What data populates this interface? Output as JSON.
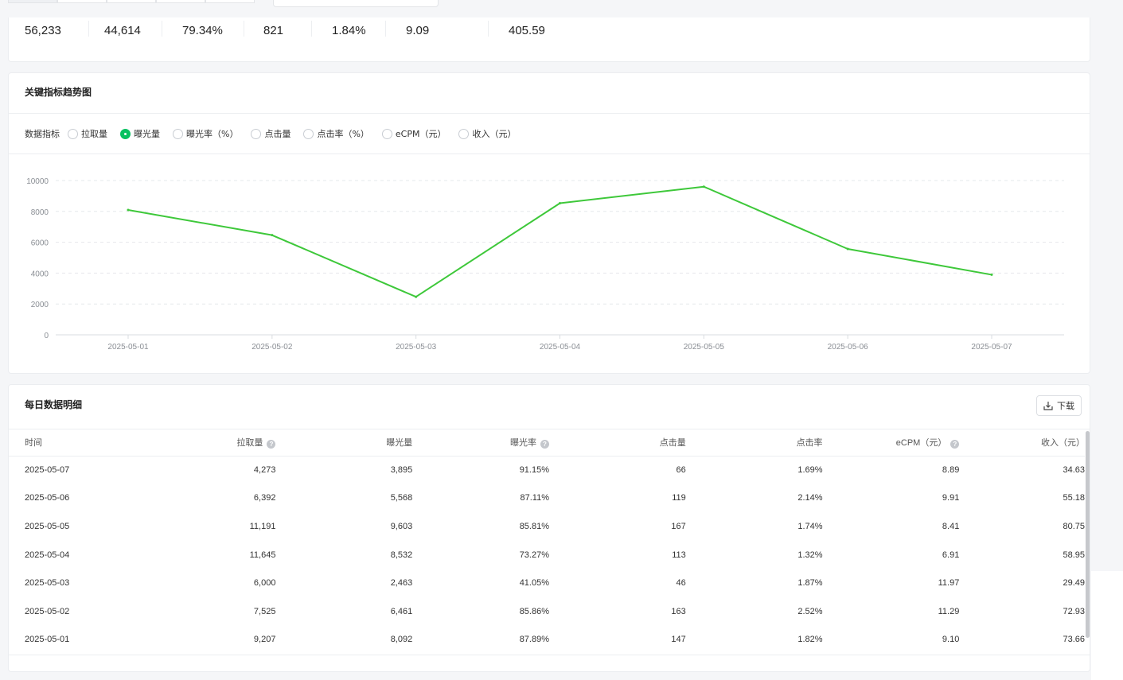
{
  "summary": {
    "values": [
      "56,233",
      "44,614",
      "79.34%",
      "821",
      "1.84%",
      "9.09",
      "405.59"
    ]
  },
  "chart_section": {
    "title": "关键指标趋势图",
    "metric_label": "数据指标",
    "metrics": [
      "拉取量",
      "曝光量",
      "曝光率（%）",
      "点击量",
      "点击率（%）",
      "eCPM（元）",
      "收入（元）"
    ],
    "selected_metric": "曝光量"
  },
  "chart_data": {
    "type": "line",
    "x": [
      "2025-05-01",
      "2025-05-02",
      "2025-05-03",
      "2025-05-04",
      "2025-05-05",
      "2025-05-06",
      "2025-05-07"
    ],
    "series": [
      {
        "values": [
          8092,
          6461,
          2463,
          8532,
          9603,
          5568,
          3895
        ]
      }
    ],
    "yticks": [
      "0",
      "2000",
      "4000",
      "6000",
      "8000",
      "10000"
    ],
    "ylim": [
      0,
      10000
    ],
    "grid": true,
    "line_color": "#3ec83a"
  },
  "table_section": {
    "title": "每日数据明细",
    "download_label": "下载",
    "columns": [
      "时间",
      "拉取量",
      "曝光量",
      "曝光率",
      "点击量",
      "点击率",
      "eCPM（元）",
      "收入（元）"
    ],
    "rows": [
      [
        "2025-05-07",
        "4,273",
        "3,895",
        "91.15%",
        "66",
        "1.69%",
        "8.89",
        "34.63"
      ],
      [
        "2025-05-06",
        "6,392",
        "5,568",
        "87.11%",
        "119",
        "2.14%",
        "9.91",
        "55.18"
      ],
      [
        "2025-05-05",
        "11,191",
        "9,603",
        "85.81%",
        "167",
        "1.74%",
        "8.41",
        "80.75"
      ],
      [
        "2025-05-04",
        "11,645",
        "8,532",
        "73.27%",
        "113",
        "1.32%",
        "6.91",
        "58.95"
      ],
      [
        "2025-05-03",
        "6,000",
        "2,463",
        "41.05%",
        "46",
        "1.87%",
        "11.97",
        "29.49"
      ],
      [
        "2025-05-02",
        "7,525",
        "6,461",
        "85.86%",
        "163",
        "2.52%",
        "11.29",
        "72.93"
      ],
      [
        "2025-05-01",
        "9,207",
        "8,092",
        "87.89%",
        "147",
        "1.82%",
        "9.10",
        "73.66"
      ]
    ]
  },
  "colors": {
    "accent": "#07c160",
    "line": "#3ec83a"
  }
}
